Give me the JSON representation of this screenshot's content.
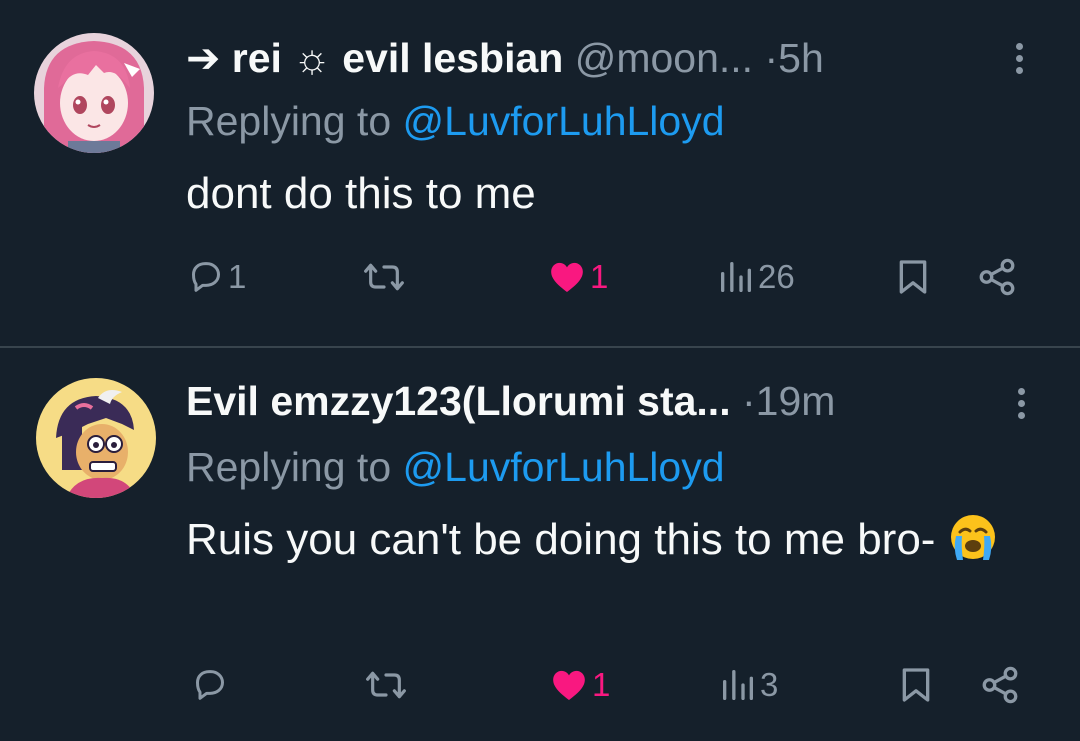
{
  "tweets": [
    {
      "display_name": "➔ rei ☼ evil lesbian",
      "handle": "@moon...",
      "dot": "·",
      "time": "5h",
      "replying_prefix": "Replying to",
      "replying_to": "@LuvforLuhLloyd",
      "text": "dont do this to me",
      "replies": "1",
      "retweets": "",
      "likes": "1",
      "views": "26",
      "liked": true,
      "avatar": "pink-haired-anime-avatar"
    },
    {
      "display_name": "Evil emzzy123(Llorumi sta...",
      "handle": "",
      "dot": "·",
      "time": "19m",
      "replying_prefix": "Replying to",
      "replying_to": "@LuvforLuhLloyd",
      "text": "Ruis you can't be doing this to me bro-",
      "emoji": "loudly-crying-face",
      "replies": "",
      "retweets": "",
      "likes": "1",
      "views": "3",
      "liked": true,
      "avatar": "cartoon-character-avatar"
    }
  ],
  "colors": {
    "background": "#15202b",
    "text_primary": "#f7f9f9",
    "text_secondary": "#8b98a5",
    "mention": "#1d9bf0",
    "like": "#f91880",
    "divider": "#38444d"
  },
  "icons": [
    "reply-icon",
    "retweet-icon",
    "heart-icon",
    "views-icon",
    "bookmark-icon",
    "share-icon",
    "more-icon"
  ]
}
